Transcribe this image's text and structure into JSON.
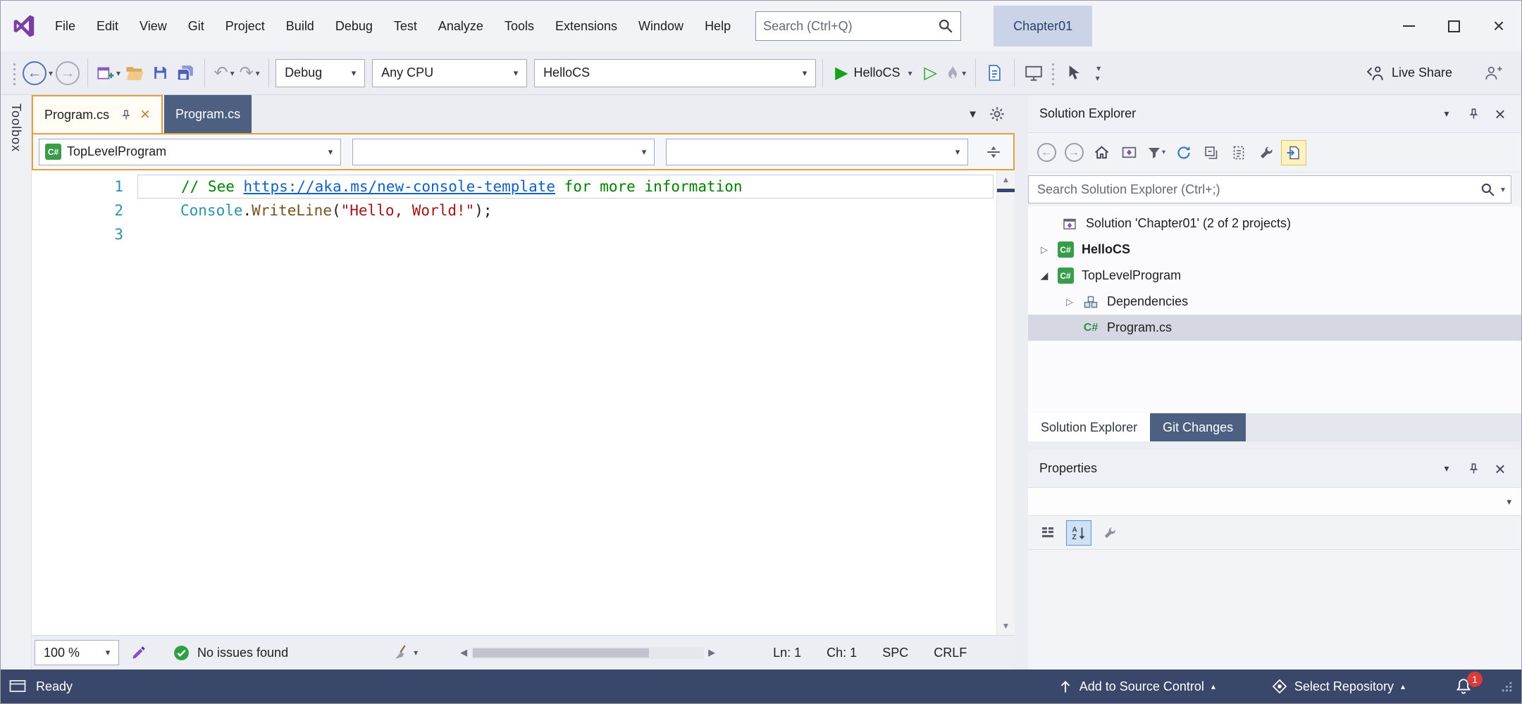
{
  "colors": {
    "accent_gold": "#E0A23E",
    "tab_inactive_blue": "#4D6082",
    "status_bar_blue": "#39476A",
    "run_green": "#18A118",
    "comment_green": "#008000",
    "link_blue": "#1060C7",
    "type_teal": "#2B91AF",
    "method_brown": "#74531F",
    "string_red": "#A31515",
    "line_number_blue": "#2B91AF",
    "notification_red": "#D93A3A"
  },
  "icons": {
    "close": "×",
    "caret_down": "▾",
    "caret_up": "▴",
    "arrow_left": "←",
    "arrow_right": "→",
    "play": "▶",
    "play_outline": "▷",
    "undo": "↶",
    "redo": "↷",
    "scroll_up": "▲",
    "scroll_down": "▼",
    "scroll_left": "◀",
    "scroll_right": "▶",
    "tab_menu": "▼",
    "expander_collapsed": "▷",
    "expander_expanded": "◢",
    "csharp_label": "C#"
  },
  "title_bar": {
    "menus": [
      "File",
      "Edit",
      "View",
      "Git",
      "Project",
      "Build",
      "Debug",
      "Test",
      "Analyze",
      "Tools",
      "Extensions",
      "Window",
      "Help"
    ],
    "search_placeholder": "Search (Ctrl+Q)",
    "solution_badge": "Chapter01"
  },
  "toolbar": {
    "configuration": "Debug",
    "platform": "Any CPU",
    "startup_project": "HelloCS",
    "run_target": "HelloCS",
    "live_share_label": "Live Share"
  },
  "toolbox": {
    "label": "Toolbox"
  },
  "editor": {
    "tabs": [
      {
        "label": "Program.cs",
        "active": true,
        "pinned": true
      },
      {
        "label": "Program.cs",
        "active": false
      }
    ],
    "navigation": {
      "project": "TopLevelProgram"
    },
    "code_lines": [
      {
        "number": "1",
        "segments": [
          {
            "text": "// See ",
            "color": "comment"
          },
          {
            "text": "https://aka.ms/new-console-template",
            "color": "link",
            "underline": true
          },
          {
            "text": " for more information",
            "color": "comment"
          }
        ]
      },
      {
        "number": "2",
        "segments": [
          {
            "text": "Console",
            "color": "type"
          },
          {
            "text": ".",
            "color": "plain"
          },
          {
            "text": "WriteLine",
            "color": "method"
          },
          {
            "text": "(",
            "color": "plain"
          },
          {
            "text": "\"Hello, World!\"",
            "color": "string"
          },
          {
            "text": ");",
            "color": "plain"
          }
        ]
      },
      {
        "number": "3",
        "segments": []
      }
    ],
    "status": {
      "zoom": "100 %",
      "health": "No issues found",
      "line": "Ln: 1",
      "column": "Ch: 1",
      "spaces": "SPC",
      "line_ending": "CRLF"
    }
  },
  "solution_explorer": {
    "title": "Solution Explorer",
    "search_placeholder": "Search Solution Explorer (Ctrl+;)",
    "tree": [
      {
        "label": "Solution 'Chapter01' (2 of 2 projects)",
        "icon": "solution",
        "indent": 0,
        "expander": "none",
        "bold": false,
        "selected": false
      },
      {
        "label": "HelloCS",
        "icon": "csharp-project",
        "indent": 1,
        "expander": "collapsed",
        "bold": true,
        "selected": false
      },
      {
        "label": "TopLevelProgram",
        "icon": "csharp-project",
        "indent": 1,
        "expander": "expanded",
        "bold": false,
        "selected": false
      },
      {
        "label": "Dependencies",
        "icon": "dependencies",
        "indent": 2,
        "expander": "collapsed",
        "bold": false,
        "selected": false
      },
      {
        "label": "Program.cs",
        "icon": "csharp-file",
        "indent": 2,
        "expander": "none",
        "bold": false,
        "selected": true
      }
    ],
    "bottom_tabs": [
      {
        "label": "Solution Explorer",
        "active": true
      },
      {
        "label": "Git Changes",
        "active": false
      }
    ]
  },
  "properties": {
    "title": "Properties"
  },
  "status_bar": {
    "ready": "Ready",
    "add_to_source_control": "Add to Source Control",
    "select_repository": "Select Repository",
    "notification_count": "1"
  }
}
